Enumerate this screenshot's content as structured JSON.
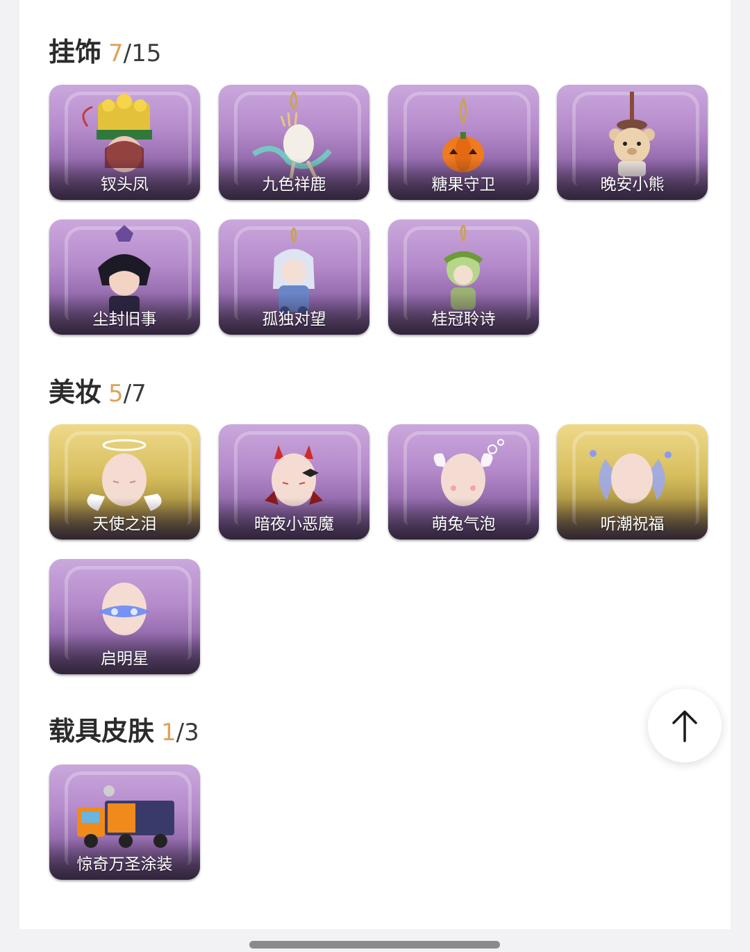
{
  "sections": [
    {
      "title": "挂饰",
      "owned": "7",
      "total": "/15",
      "items": [
        {
          "label": "钗头凤",
          "icon": "phoenix-crown-pendant-icon",
          "tone": "purple"
        },
        {
          "label": "九色祥鹿",
          "icon": "deer-pendant-icon",
          "tone": "purple"
        },
        {
          "label": "糖果守卫",
          "icon": "pumpkin-pendant-icon",
          "tone": "purple"
        },
        {
          "label": "晚安小熊",
          "icon": "bear-pendant-icon",
          "tone": "purple"
        },
        {
          "label": "尘封旧事",
          "icon": "dark-prince-pendant-icon",
          "tone": "purple"
        },
        {
          "label": "孤独对望",
          "icon": "lonely-girl-pendant-icon",
          "tone": "purple"
        },
        {
          "label": "桂冠聆诗",
          "icon": "laurel-pendant-icon",
          "tone": "purple"
        }
      ]
    },
    {
      "title": "美妆",
      "owned": "5",
      "total": "/7",
      "items": [
        {
          "label": "天使之泪",
          "icon": "angel-face-icon",
          "tone": "gold"
        },
        {
          "label": "暗夜小恶魔",
          "icon": "devil-face-icon",
          "tone": "purple"
        },
        {
          "label": "萌兔气泡",
          "icon": "bunny-bubble-face-icon",
          "tone": "purple"
        },
        {
          "label": "听潮祝福",
          "icon": "tide-wings-face-icon",
          "tone": "gold"
        },
        {
          "label": "启明星",
          "icon": "star-mask-face-icon",
          "tone": "purple"
        }
      ]
    },
    {
      "title": "载具皮肤",
      "owned": "1",
      "total": "/3",
      "items": [
        {
          "label": "惊奇万圣涂装",
          "icon": "halloween-truck-icon",
          "tone": "purple"
        }
      ]
    }
  ],
  "scroll_top_button": {
    "icon": "arrow-up-icon"
  }
}
